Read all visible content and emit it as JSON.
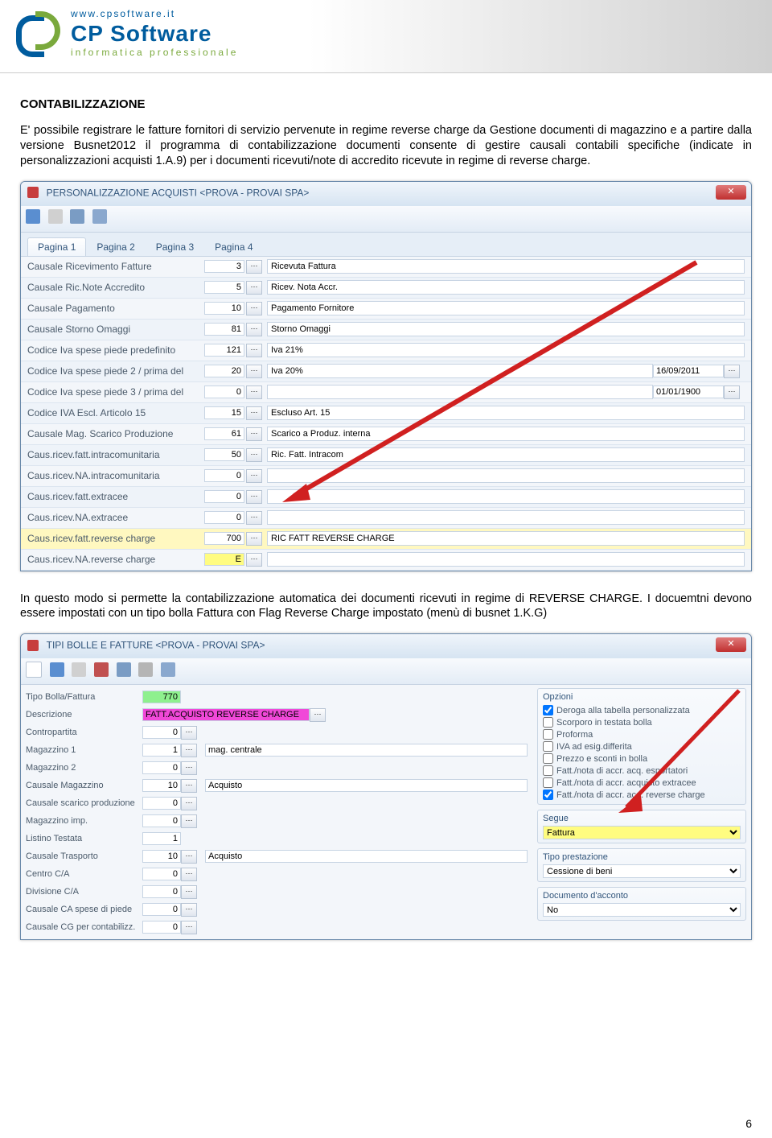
{
  "header": {
    "url": "www.cpsoftware.it",
    "brand": "CP Software",
    "tagline": "informatica professionale"
  },
  "doc": {
    "h_contab": "CONTABILIZZAZIONE",
    "p1": "E' possibile registrare le fatture fornitori di servizio pervenute in regime reverse charge da Gestione documenti di magazzino e a partire dalla versione Busnet2012 il programma di contabilizzazione documenti consente di gestire causali contabili specifiche (indicate in personalizzazioni acquisti 1.A.9) per i documenti ricevuti/note di accredito ricevute in regime di reverse charge.",
    "p2": "In questo modo si permette la contabilizzazione automatica dei documenti ricevuti in regime di REVERSE CHARGE. I docuemtni devono essere impostati con un tipo bolla Fattura con Flag Reverse Charge impostato (menù di busnet 1.K.G)",
    "pagenum": "6"
  },
  "win1": {
    "title": "PERSONALIZZAZIONE ACQUISTI <PROVA - PROVAI SPA>",
    "tabs": [
      "Pagina 1",
      "Pagina 2",
      "Pagina 3",
      "Pagina 4"
    ],
    "rows": [
      {
        "label": "Causale Ricevimento Fatture",
        "v": "3",
        "d": "Ricevuta Fattura"
      },
      {
        "label": "Causale Ric.Note Accredito",
        "v": "5",
        "d": "Ricev. Nota Accr."
      },
      {
        "label": "Causale Pagamento",
        "v": "10",
        "d": "Pagamento Fornitore"
      },
      {
        "label": "Causale Storno Omaggi",
        "v": "81",
        "d": "Storno Omaggi"
      },
      {
        "label": "Codice Iva spese piede predefinito",
        "v": "121",
        "d": "Iva 21%"
      },
      {
        "label": "Codice Iva spese piede 2 / prima del",
        "v": "20",
        "d": "Iva 20%",
        "date": "16/09/2011"
      },
      {
        "label": "Codice Iva spese piede 3 / prima del",
        "v": "0",
        "d": "",
        "date": "01/01/1900"
      },
      {
        "label": "Codice IVA Escl. Articolo 15",
        "v": "15",
        "d": "Escluso Art. 15"
      },
      {
        "label": "Causale Mag. Scarico Produzione",
        "v": "61",
        "d": "Scarico a Produz. interna"
      },
      {
        "label": "Caus.ricev.fatt.intracomunitaria",
        "v": "50",
        "d": "Ric. Fatt. Intracom"
      },
      {
        "label": "Caus.ricev.NA.intracomunitaria",
        "v": "0",
        "d": ""
      },
      {
        "label": "Caus.ricev.fatt.extracee",
        "v": "0",
        "d": ""
      },
      {
        "label": "Caus.ricev.NA.extracee",
        "v": "0",
        "d": ""
      },
      {
        "label": "Caus.ricev.fatt.reverse charge",
        "v": "700",
        "d": "RIC FATT REVERSE CHARGE",
        "hl": true
      },
      {
        "label": "Caus.ricev.NA.reverse charge",
        "v": "E",
        "d": "",
        "yellow": true
      }
    ]
  },
  "win2": {
    "title": "TIPI BOLLE E FATTURE <PROVA - PROVAI SPA>",
    "left": [
      {
        "label": "Tipo Bolla/Fattura",
        "v": "770",
        "cls": "green"
      },
      {
        "label": "Descrizione",
        "v": "FATT.ACQUISTO REVERSE CHARGE",
        "cls": "magenta",
        "ell": true
      },
      {
        "label": "Contropartita",
        "v": "0",
        "ell": true
      },
      {
        "label": "Magazzino 1",
        "v": "1",
        "ell": true,
        "d": "mag. centrale"
      },
      {
        "label": "Magazzino 2",
        "v": "0",
        "ell": true
      },
      {
        "label": "Causale Magazzino",
        "v": "10",
        "ell": true,
        "d": "Acquisto"
      },
      {
        "label": "Causale scarico produzione",
        "v": "0",
        "ell": true
      },
      {
        "label": "Magazzino imp.",
        "v": "0",
        "ell": true
      },
      {
        "label": "Listino Testata",
        "v": "1"
      },
      {
        "label": "Causale Trasporto",
        "v": "10",
        "ell": true,
        "d": "Acquisto"
      },
      {
        "label": "Centro C/A",
        "v": "0",
        "ell": true
      },
      {
        "label": "Divisione C/A",
        "v": "0",
        "ell": true
      },
      {
        "label": "Causale CA spese di piede",
        "v": "0",
        "ell": true
      },
      {
        "label": "Causale CG per contabilizz.",
        "v": "0",
        "ell": true
      }
    ],
    "opts_title": "Opzioni",
    "opts": [
      {
        "t": "Deroga alla tabella personalizzata",
        "c": true
      },
      {
        "t": "Scorporo in testata bolla",
        "c": false
      },
      {
        "t": "Proforma",
        "c": false
      },
      {
        "t": "IVA ad esig.differita",
        "c": false
      },
      {
        "t": "Prezzo e sconti in bolla",
        "c": false
      },
      {
        "t": "Fatt./nota di accr. acq. esportatori",
        "c": false
      },
      {
        "t": "Fatt./nota di accr. acquisto extracee",
        "c": false
      },
      {
        "t": "Fatt./nota di accr. acq. reverse charge",
        "c": true
      }
    ],
    "segue_title": "Segue",
    "segue_val": "Fattura",
    "prest_title": "Tipo prestazione",
    "prest_val": "Cessione di beni",
    "docacc_title": "Documento d'acconto",
    "docacc_val": "No"
  }
}
